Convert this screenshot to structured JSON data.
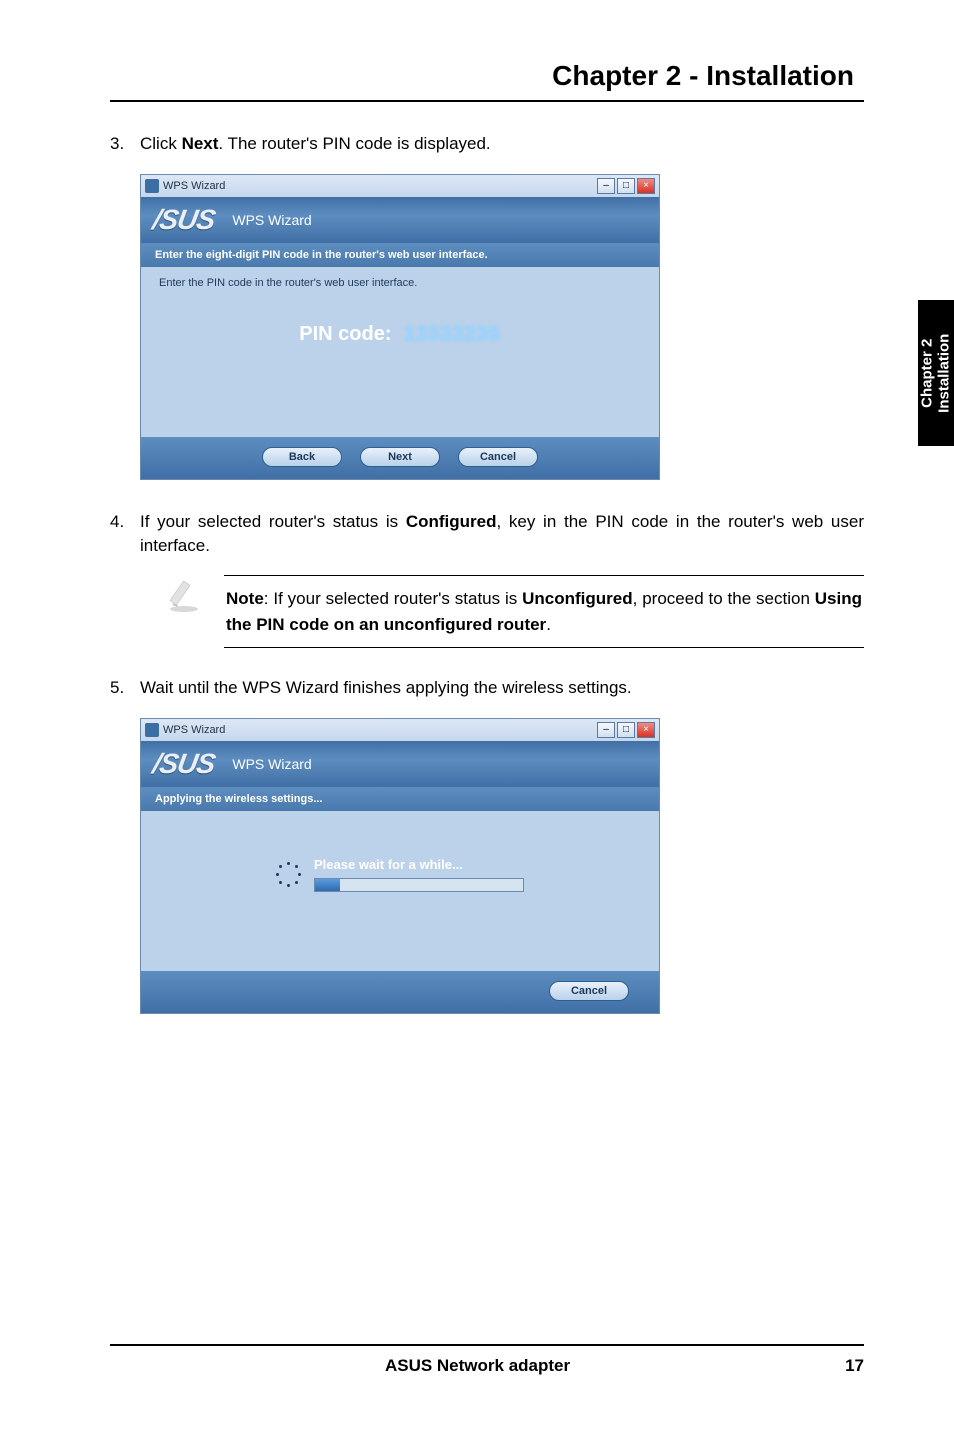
{
  "chapter_title": "Chapter 2 - Installation",
  "side_tab": {
    "line1": "Chapter 2",
    "line2": "Installation"
  },
  "steps": {
    "s3": {
      "num": "3.",
      "text_a": "Click ",
      "bold": "Next",
      "text_b": ". The router's PIN code is displayed."
    },
    "s4": {
      "num": "4.",
      "text_a": "If your selected router's status is ",
      "bold": "Configured",
      "text_b": ", key in the PIN code in the router's web user interface."
    },
    "s5": {
      "num": "5.",
      "text": "Wait until the WPS Wizard finishes applying the wireless settings."
    }
  },
  "note": {
    "lead": "Note",
    "text_a": ": If your selected router's status is ",
    "bold1": "Unconfigured",
    "text_b": ", proceed to the section ",
    "bold2": "Using the PIN code on an unconfigured router",
    "text_c": "."
  },
  "win1": {
    "titlebar": "WPS Wizard",
    "header": "WPS Wizard",
    "sub": "Enter the eight-digit PIN code in the router's web user interface.",
    "instruction": "Enter the PIN code in the router's web user interface.",
    "pin_label": "PIN code:",
    "pin_value": "13533236",
    "btn_back": "Back",
    "btn_next": "Next",
    "btn_cancel": "Cancel"
  },
  "win2": {
    "titlebar": "WPS Wizard",
    "header": "WPS Wizard",
    "sub": "Applying the wireless settings...",
    "progress_title": "Please wait for a while...",
    "progress_pct": 12,
    "btn_cancel": "Cancel"
  },
  "footer": {
    "left": "ASUS Network adapter",
    "right": "17"
  },
  "icons": {
    "minimize": "–",
    "maximize": "□",
    "close": "×"
  },
  "logo": "/SUS"
}
